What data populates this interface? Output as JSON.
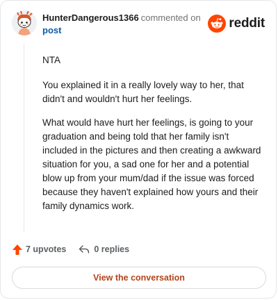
{
  "comment": {
    "username": "HunterDangerous1366",
    "action": "commented on",
    "post_link": "post",
    "paragraphs": [
      "NTA",
      "You explained it in a really lovely way to her, that didn't and wouldn't hurt her feelings.",
      "What would have hurt her feelings, is going to your graduation and being told that her family isn't included in the pictures and then creating a awkward situation for you, a sad one for her and a potential blow up from your mum/dad if the issue was forced because they haven't explained how yours and their family dynamics work."
    ],
    "upvotes_label": "7 upvotes",
    "replies_label": "0 replies"
  },
  "brand": {
    "name": "reddit",
    "accent_color": "#ff4500"
  },
  "icons": {
    "avatar": "snoo-avatar",
    "logo": "reddit-snoo-icon",
    "upvote": "upvote-arrow-icon",
    "reply": "reply-arrow-icon"
  },
  "footer": {
    "view_button_label": "View the conversation"
  }
}
